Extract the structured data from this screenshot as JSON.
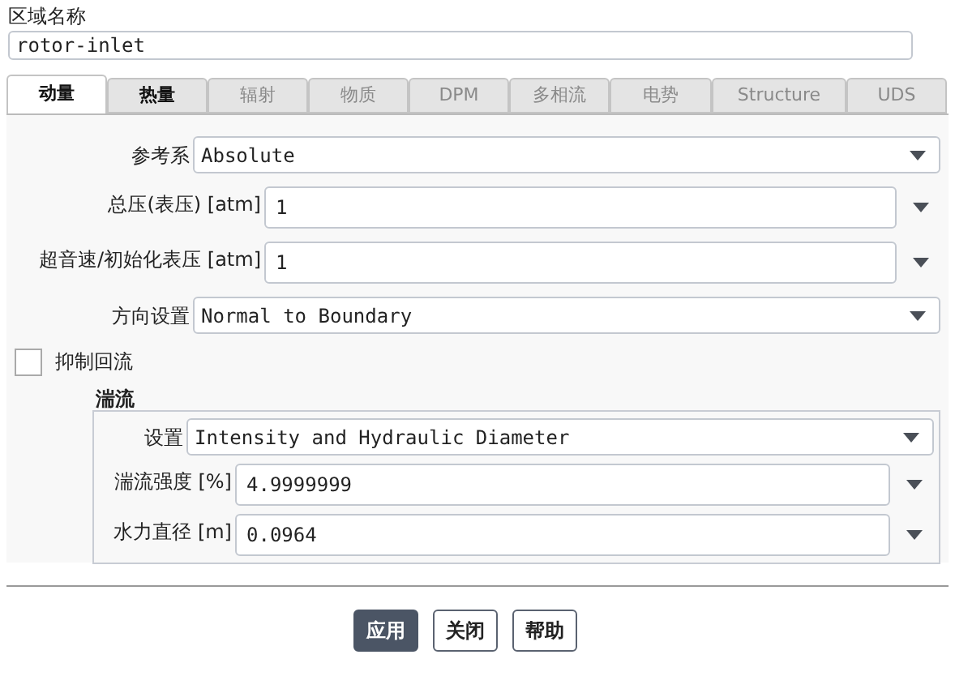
{
  "zone_name": {
    "label": "区域名称",
    "value": "rotor-inlet"
  },
  "tabs": [
    {
      "label": "动量",
      "selected": true,
      "disabled": false
    },
    {
      "label": "热量",
      "selected": false,
      "disabled": false
    },
    {
      "label": "辐射",
      "selected": false,
      "disabled": true
    },
    {
      "label": "物质",
      "selected": false,
      "disabled": true
    },
    {
      "label": "DPM",
      "selected": false,
      "disabled": true
    },
    {
      "label": "多相流",
      "selected": false,
      "disabled": true
    },
    {
      "label": "电势",
      "selected": false,
      "disabled": true
    },
    {
      "label": "Structure",
      "selected": false,
      "disabled": true
    },
    {
      "label": "UDS",
      "selected": false,
      "disabled": true
    }
  ],
  "fields": [
    {
      "kind": "dropdown",
      "label": "参考系",
      "value": "Absolute"
    },
    {
      "kind": "number",
      "label": "总压(表压) [atm]",
      "value": "1"
    },
    {
      "kind": "number",
      "label": "超音速/初始化表压 [atm]",
      "value": "1"
    },
    {
      "kind": "dropdown",
      "label": "方向设置",
      "value": "Normal to Boundary"
    }
  ],
  "backflow": {
    "label": "抑制回流",
    "checked": false
  },
  "turbulence": {
    "title": "湍流",
    "fields": [
      {
        "kind": "dropdown",
        "label": "设置",
        "value": "Intensity and Hydraulic Diameter"
      },
      {
        "kind": "number",
        "label": "湍流强度 [%]",
        "value": "4.9999999"
      },
      {
        "kind": "number",
        "label": "水力直径 [m]",
        "value": "0.0964"
      }
    ]
  },
  "buttons": [
    {
      "label": "应用",
      "primary": true
    },
    {
      "label": "关闭",
      "primary": false
    },
    {
      "label": "帮助",
      "primary": false
    }
  ]
}
